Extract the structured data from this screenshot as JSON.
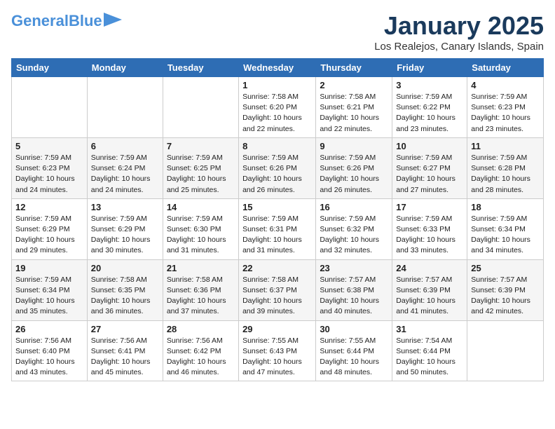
{
  "header": {
    "logo_general": "General",
    "logo_blue": "Blue",
    "month_year": "January 2025",
    "location": "Los Realejos, Canary Islands, Spain"
  },
  "weekdays": [
    "Sunday",
    "Monday",
    "Tuesday",
    "Wednesday",
    "Thursday",
    "Friday",
    "Saturday"
  ],
  "weeks": [
    [
      {
        "day": "",
        "sunrise": "",
        "sunset": "",
        "daylight": ""
      },
      {
        "day": "",
        "sunrise": "",
        "sunset": "",
        "daylight": ""
      },
      {
        "day": "",
        "sunrise": "",
        "sunset": "",
        "daylight": ""
      },
      {
        "day": "1",
        "sunrise": "Sunrise: 7:58 AM",
        "sunset": "Sunset: 6:20 PM",
        "daylight": "Daylight: 10 hours and 22 minutes."
      },
      {
        "day": "2",
        "sunrise": "Sunrise: 7:58 AM",
        "sunset": "Sunset: 6:21 PM",
        "daylight": "Daylight: 10 hours and 22 minutes."
      },
      {
        "day": "3",
        "sunrise": "Sunrise: 7:59 AM",
        "sunset": "Sunset: 6:22 PM",
        "daylight": "Daylight: 10 hours and 23 minutes."
      },
      {
        "day": "4",
        "sunrise": "Sunrise: 7:59 AM",
        "sunset": "Sunset: 6:23 PM",
        "daylight": "Daylight: 10 hours and 23 minutes."
      }
    ],
    [
      {
        "day": "5",
        "sunrise": "Sunrise: 7:59 AM",
        "sunset": "Sunset: 6:23 PM",
        "daylight": "Daylight: 10 hours and 24 minutes."
      },
      {
        "day": "6",
        "sunrise": "Sunrise: 7:59 AM",
        "sunset": "Sunset: 6:24 PM",
        "daylight": "Daylight: 10 hours and 24 minutes."
      },
      {
        "day": "7",
        "sunrise": "Sunrise: 7:59 AM",
        "sunset": "Sunset: 6:25 PM",
        "daylight": "Daylight: 10 hours and 25 minutes."
      },
      {
        "day": "8",
        "sunrise": "Sunrise: 7:59 AM",
        "sunset": "Sunset: 6:26 PM",
        "daylight": "Daylight: 10 hours and 26 minutes."
      },
      {
        "day": "9",
        "sunrise": "Sunrise: 7:59 AM",
        "sunset": "Sunset: 6:26 PM",
        "daylight": "Daylight: 10 hours and 26 minutes."
      },
      {
        "day": "10",
        "sunrise": "Sunrise: 7:59 AM",
        "sunset": "Sunset: 6:27 PM",
        "daylight": "Daylight: 10 hours and 27 minutes."
      },
      {
        "day": "11",
        "sunrise": "Sunrise: 7:59 AM",
        "sunset": "Sunset: 6:28 PM",
        "daylight": "Daylight: 10 hours and 28 minutes."
      }
    ],
    [
      {
        "day": "12",
        "sunrise": "Sunrise: 7:59 AM",
        "sunset": "Sunset: 6:29 PM",
        "daylight": "Daylight: 10 hours and 29 minutes."
      },
      {
        "day": "13",
        "sunrise": "Sunrise: 7:59 AM",
        "sunset": "Sunset: 6:29 PM",
        "daylight": "Daylight: 10 hours and 30 minutes."
      },
      {
        "day": "14",
        "sunrise": "Sunrise: 7:59 AM",
        "sunset": "Sunset: 6:30 PM",
        "daylight": "Daylight: 10 hours and 31 minutes."
      },
      {
        "day": "15",
        "sunrise": "Sunrise: 7:59 AM",
        "sunset": "Sunset: 6:31 PM",
        "daylight": "Daylight: 10 hours and 31 minutes."
      },
      {
        "day": "16",
        "sunrise": "Sunrise: 7:59 AM",
        "sunset": "Sunset: 6:32 PM",
        "daylight": "Daylight: 10 hours and 32 minutes."
      },
      {
        "day": "17",
        "sunrise": "Sunrise: 7:59 AM",
        "sunset": "Sunset: 6:33 PM",
        "daylight": "Daylight: 10 hours and 33 minutes."
      },
      {
        "day": "18",
        "sunrise": "Sunrise: 7:59 AM",
        "sunset": "Sunset: 6:34 PM",
        "daylight": "Daylight: 10 hours and 34 minutes."
      }
    ],
    [
      {
        "day": "19",
        "sunrise": "Sunrise: 7:59 AM",
        "sunset": "Sunset: 6:34 PM",
        "daylight": "Daylight: 10 hours and 35 minutes."
      },
      {
        "day": "20",
        "sunrise": "Sunrise: 7:58 AM",
        "sunset": "Sunset: 6:35 PM",
        "daylight": "Daylight: 10 hours and 36 minutes."
      },
      {
        "day": "21",
        "sunrise": "Sunrise: 7:58 AM",
        "sunset": "Sunset: 6:36 PM",
        "daylight": "Daylight: 10 hours and 37 minutes."
      },
      {
        "day": "22",
        "sunrise": "Sunrise: 7:58 AM",
        "sunset": "Sunset: 6:37 PM",
        "daylight": "Daylight: 10 hours and 39 minutes."
      },
      {
        "day": "23",
        "sunrise": "Sunrise: 7:57 AM",
        "sunset": "Sunset: 6:38 PM",
        "daylight": "Daylight: 10 hours and 40 minutes."
      },
      {
        "day": "24",
        "sunrise": "Sunrise: 7:57 AM",
        "sunset": "Sunset: 6:39 PM",
        "daylight": "Daylight: 10 hours and 41 minutes."
      },
      {
        "day": "25",
        "sunrise": "Sunrise: 7:57 AM",
        "sunset": "Sunset: 6:39 PM",
        "daylight": "Daylight: 10 hours and 42 minutes."
      }
    ],
    [
      {
        "day": "26",
        "sunrise": "Sunrise: 7:56 AM",
        "sunset": "Sunset: 6:40 PM",
        "daylight": "Daylight: 10 hours and 43 minutes."
      },
      {
        "day": "27",
        "sunrise": "Sunrise: 7:56 AM",
        "sunset": "Sunset: 6:41 PM",
        "daylight": "Daylight: 10 hours and 45 minutes."
      },
      {
        "day": "28",
        "sunrise": "Sunrise: 7:56 AM",
        "sunset": "Sunset: 6:42 PM",
        "daylight": "Daylight: 10 hours and 46 minutes."
      },
      {
        "day": "29",
        "sunrise": "Sunrise: 7:55 AM",
        "sunset": "Sunset: 6:43 PM",
        "daylight": "Daylight: 10 hours and 47 minutes."
      },
      {
        "day": "30",
        "sunrise": "Sunrise: 7:55 AM",
        "sunset": "Sunset: 6:44 PM",
        "daylight": "Daylight: 10 hours and 48 minutes."
      },
      {
        "day": "31",
        "sunrise": "Sunrise: 7:54 AM",
        "sunset": "Sunset: 6:44 PM",
        "daylight": "Daylight: 10 hours and 50 minutes."
      },
      {
        "day": "",
        "sunrise": "",
        "sunset": "",
        "daylight": ""
      }
    ]
  ]
}
